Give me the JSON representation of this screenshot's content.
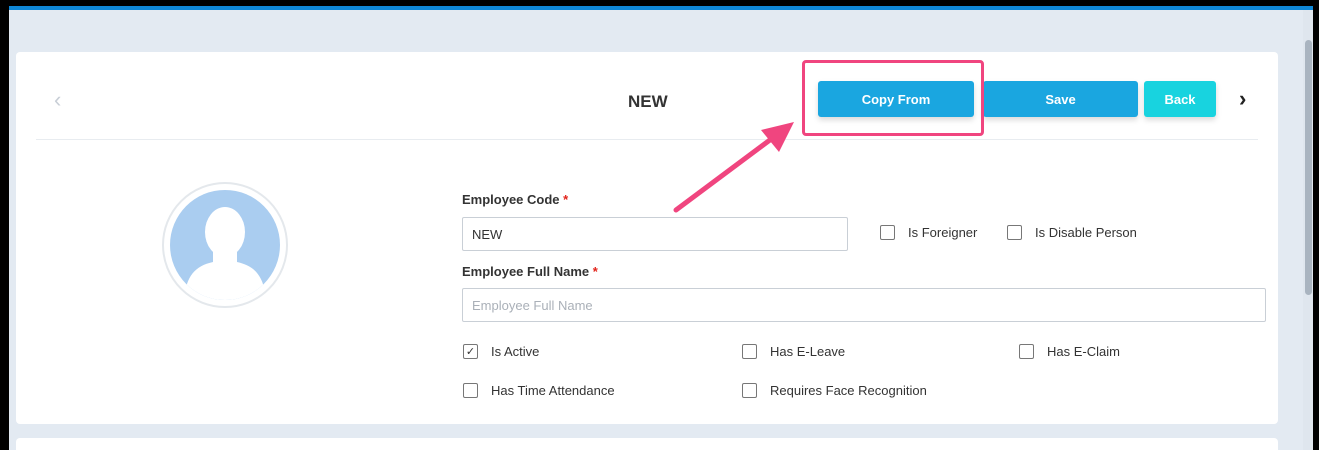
{
  "header": {
    "title": "NEW",
    "copy_from_label": "Copy From",
    "save_label": "Save",
    "back_label": "Back",
    "prev_icon": "‹",
    "next_icon": "›"
  },
  "form": {
    "employee_code": {
      "label": "Employee Code",
      "required": "*",
      "value": "NEW"
    },
    "employee_full_name": {
      "label": "Employee Full Name",
      "required": "*",
      "placeholder": "Employee Full Name",
      "value": ""
    },
    "checkboxes": {
      "is_foreigner": {
        "label": "Is Foreigner",
        "checked": false
      },
      "is_disable_person": {
        "label": "Is Disable Person",
        "checked": false
      },
      "is_active": {
        "label": "Is Active",
        "checked": true,
        "mark": "✓"
      },
      "has_e_leave": {
        "label": "Has E-Leave",
        "checked": false
      },
      "has_e_claim": {
        "label": "Has E-Claim",
        "checked": false
      },
      "has_time_attendance": {
        "label": "Has Time Attendance",
        "checked": false
      },
      "requires_face_recognition": {
        "label": "Requires Face Recognition",
        "checked": false
      }
    }
  },
  "colors": {
    "primary_button": "#1aa6e0",
    "back_button": "#18d3df",
    "highlight": "#f0457f",
    "avatar": "#aacdf0"
  }
}
